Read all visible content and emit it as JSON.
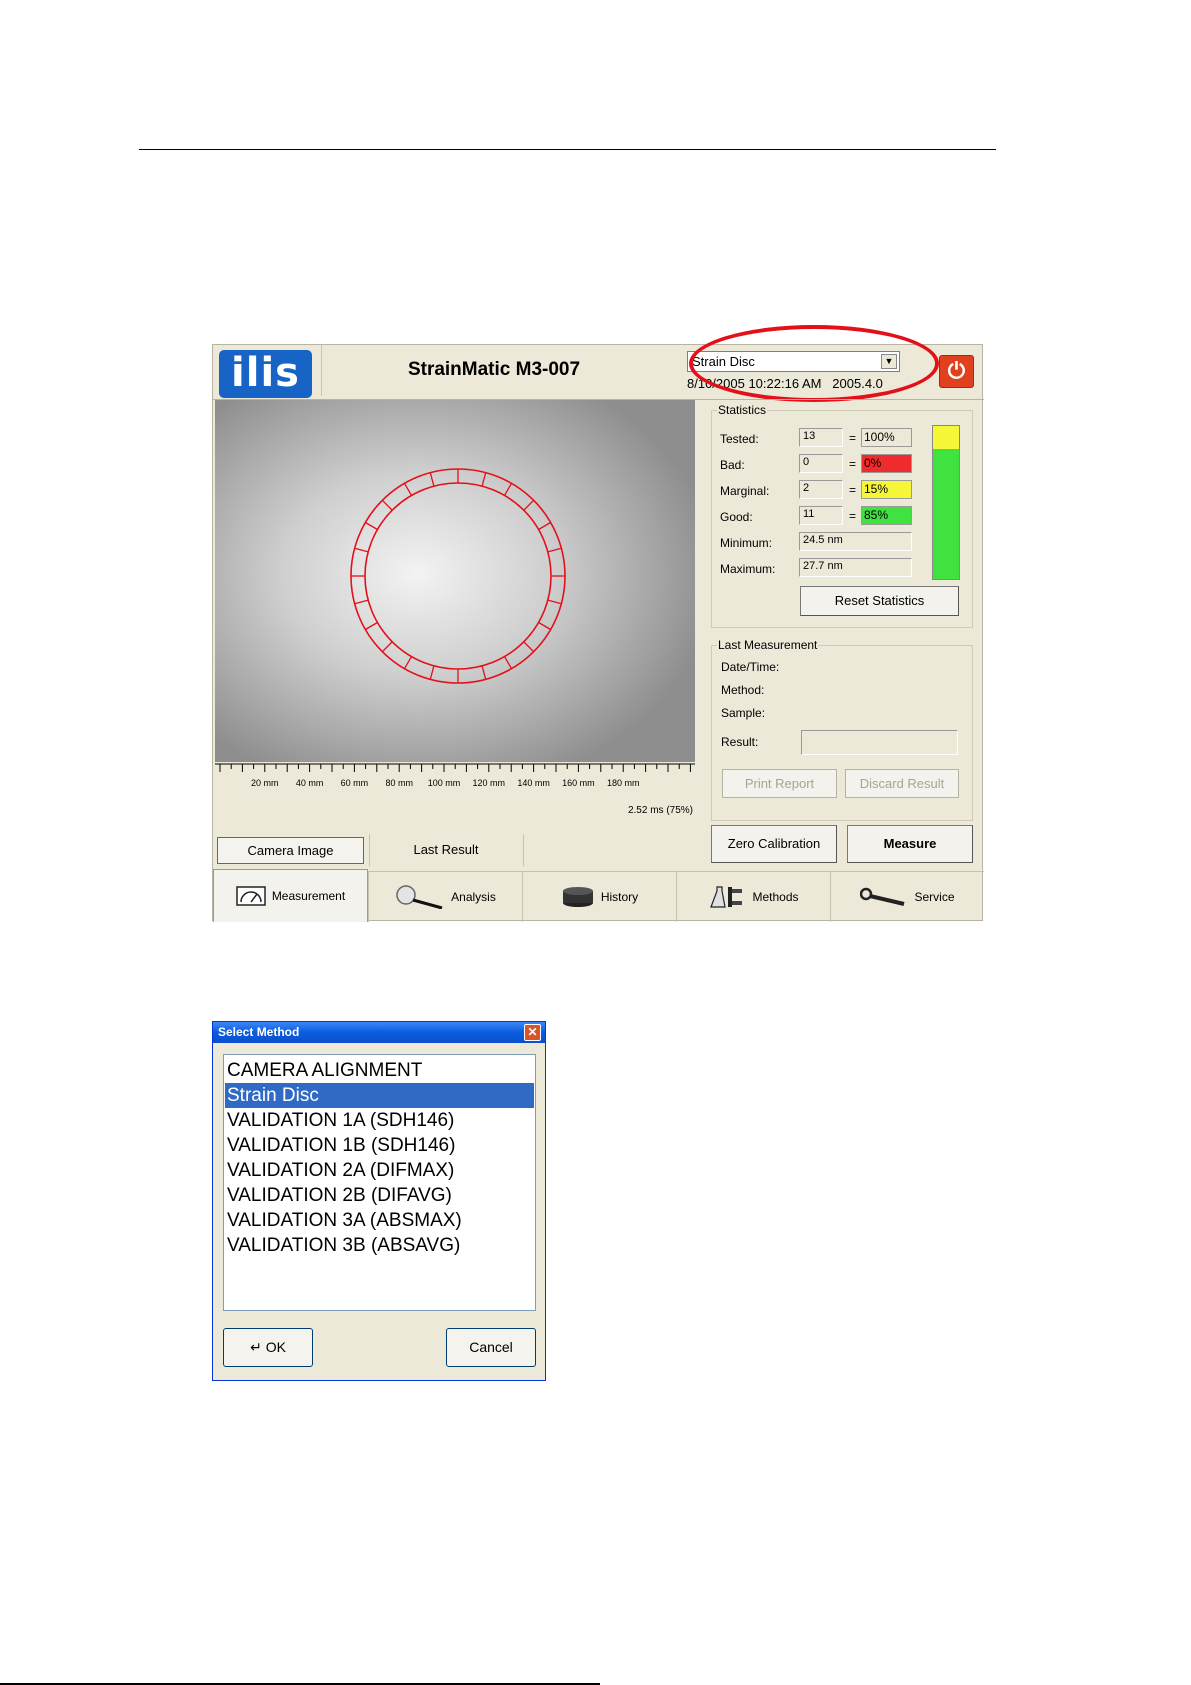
{
  "app": {
    "logo_text": "ilis",
    "title": "StrainMatic M3-007",
    "method_selected": "Strain Disc",
    "datetime": "8/10/2005 10:22:16 AM",
    "version": "2005.4.0"
  },
  "camera": {
    "ruler_labels": [
      "20 mm",
      "40 mm",
      "60 mm",
      "80 mm",
      "100 mm",
      "120 mm",
      "140 mm",
      "160 mm",
      "180 mm"
    ],
    "exposure": "2.52 ms",
    "exposure_pct": "(75%)",
    "overlay_color": "#e3101a"
  },
  "statistics": {
    "title": "Statistics",
    "tested_label": "Tested:",
    "tested_value": "13",
    "tested_pct": "100%",
    "bad_label": "Bad:",
    "bad_value": "0",
    "bad_pct": "0%",
    "marginal_label": "Marginal:",
    "marginal_value": "2",
    "marginal_pct": "15%",
    "good_label": "Good:",
    "good_value": "11",
    "good_pct": "85%",
    "eq": "=",
    "minimum_label": "Minimum:",
    "minimum_value": "24.5 nm",
    "maximum_label": "Maximum:",
    "maximum_value": "27.7 nm",
    "reset_label": "Reset Statistics",
    "colors": {
      "bad": "#ef2b2b",
      "marginal": "#f7f73a",
      "good": "#3fe23f"
    },
    "bar": {
      "marginal_fraction": 0.15,
      "good_fraction": 0.85
    }
  },
  "last_measurement": {
    "title": "Last Measurement",
    "datetime_label": "Date/Time:",
    "method_label": "Method:",
    "sample_label": "Sample:",
    "result_label": "Result:",
    "result_value": "",
    "print_label": "Print Report",
    "discard_label": "Discard Result"
  },
  "actions": {
    "zero_label": "Zero Calibration",
    "measure_label": "Measure"
  },
  "view_tabs": {
    "camera_label": "Camera Image",
    "last_result_label": "Last Result"
  },
  "main_tabs": {
    "measurement": "Measurement",
    "analysis": "Analysis",
    "history": "History",
    "methods": "Methods",
    "service": "Service"
  },
  "dialog": {
    "title": "Select Method",
    "items": [
      "CAMERA ALIGNMENT",
      "Strain Disc",
      "VALIDATION 1A (SDH146)",
      "VALIDATION 1B (SDH146)",
      "VALIDATION 2A (DIFMAX)",
      "VALIDATION 2B (DIFAVG)",
      "VALIDATION 3A (ABSMAX)",
      "VALIDATION 3B (ABSAVG)"
    ],
    "selected_index": 1,
    "ok_label": "OK",
    "cancel_label": "Cancel"
  }
}
